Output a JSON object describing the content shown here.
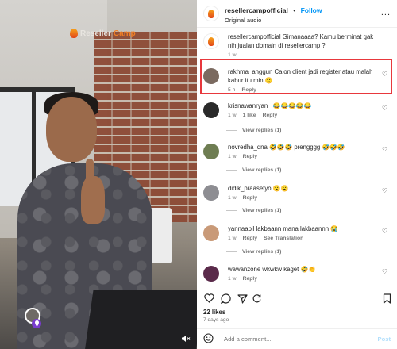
{
  "video": {
    "watermark_a": "Reseller",
    "watermark_b": "Camp",
    "icons": {
      "pin": "pin-icon",
      "mute": "volume-mute-icon"
    }
  },
  "header": {
    "username": "resellercampofficial",
    "dot": "•",
    "follow_label": "Follow",
    "audio": "Original audio",
    "more": "..."
  },
  "comments": [
    {
      "user": "resellercampofficial",
      "text": "Gimanaaaa? Kamu berminat gak nih jualan domain di resellercamp ?",
      "time": "1 w",
      "likes": "",
      "reply": "",
      "see_translation": "",
      "view_replies": ""
    },
    {
      "user": "rakhma_anggun",
      "text": "Calon client jadi register atau malah kabur itu min 🙂",
      "time": "5 h",
      "likes": "",
      "reply": "Reply",
      "see_translation": "",
      "view_replies": ""
    },
    {
      "user": "krisnawanryan_",
      "text": "😂😂😂😂😂",
      "time": "1 w",
      "likes": "1 like",
      "reply": "Reply",
      "see_translation": "",
      "view_replies": "View replies (1)"
    },
    {
      "user": "novredha_dna",
      "text": "🤣🤣🤣 prengggg 🤣🤣🤣",
      "time": "1 w",
      "likes": "",
      "reply": "Reply",
      "see_translation": "",
      "view_replies": "View replies (1)"
    },
    {
      "user": "didik_praasetyo",
      "text": "😮😮",
      "time": "1 w",
      "likes": "",
      "reply": "Reply",
      "see_translation": "",
      "view_replies": "View replies (1)"
    },
    {
      "user": "yannaabil",
      "text": "lakbaann mana lakbaannn 😭",
      "time": "1 w",
      "likes": "",
      "reply": "Reply",
      "see_translation": "See Translation",
      "view_replies": "View replies (1)"
    },
    {
      "user": "wawanzone",
      "text": "wkwkw kaget 🤣👏",
      "time": "1 w",
      "likes": "",
      "reply": "Reply",
      "see_translation": "",
      "view_replies": ""
    }
  ],
  "actions": {
    "like_icon": "heart-outline-icon",
    "comment_icon": "comment-icon",
    "share_icon": "share-icon",
    "save_icon": "bookmark-icon",
    "likes": "22 likes",
    "ago": "7 days ago"
  },
  "add_comment": {
    "placeholder": "Add a comment...",
    "post_label": "Post"
  },
  "colors": {
    "follow": "#0095f6",
    "highlight": "#e8383d",
    "post_disabled": "#b2dffc"
  }
}
